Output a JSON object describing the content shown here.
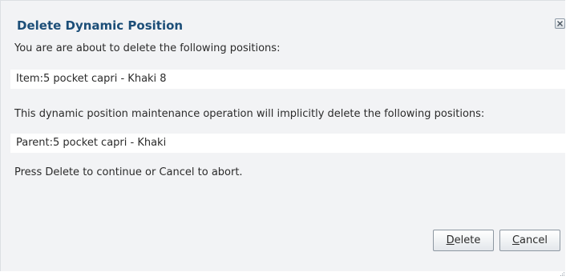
{
  "dialog": {
    "title": "Delete Dynamic Position",
    "close_icon": "close-x-icon",
    "intro_text": "You are are about to delete the following positions:",
    "item_value": "Item:5 pocket capri - Khaki 8",
    "implicit_text": "This dynamic position maintenance operation will implicitly delete the following positions:",
    "parent_value": "Parent:5 pocket capri - Khaki",
    "press_text": "Press Delete to continue or Cancel to abort."
  },
  "buttons": {
    "delete_mnemonic": "D",
    "delete_rest": "elete",
    "cancel_mnemonic": "C",
    "cancel_rest": "ancel"
  },
  "colors": {
    "title": "#1c4e78",
    "panel_background": "#f2f3f5",
    "value_background": "#ffffff"
  }
}
